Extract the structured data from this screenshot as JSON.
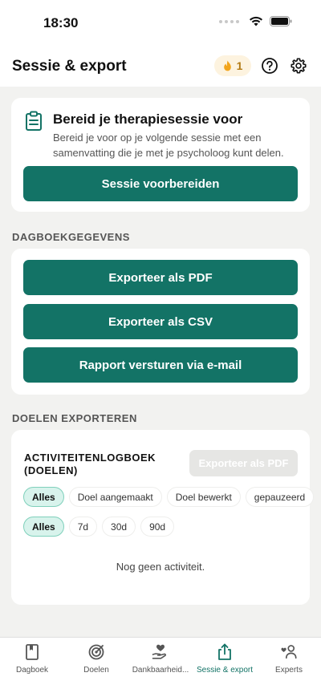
{
  "status_bar": {
    "time": "18:30"
  },
  "header": {
    "title": "Sessie & export",
    "streak_count": "1"
  },
  "session": {
    "title": "Bereid je therapiesessie voor",
    "description": "Bereid je voor op je volgende sessie met een samenvatting die je met je psycholoog kunt delen.",
    "button_label": "Sessie voorbereiden"
  },
  "diary": {
    "section_label": "DAGBOEKGEGEVENS",
    "buttons": [
      "Exporteer als PDF",
      "Exporteer als CSV",
      "Rapport versturen via e-mail"
    ]
  },
  "goals": {
    "section_label": "DOELEN EXPORTEREN",
    "log_title": "ACTIVITEITENLOGBOEK (DOELEN)",
    "export_button": "Exporteer als PDF",
    "type_filters": [
      "Alles",
      "Doel aangemaakt",
      "Doel bewerkt",
      "gepauzeerd"
    ],
    "period_filters": [
      "Alles",
      "7d",
      "30d",
      "90d"
    ],
    "empty_text": "Nog geen activiteit."
  },
  "tabs": [
    {
      "label": "Dagboek",
      "icon": "book-icon"
    },
    {
      "label": "Doelen",
      "icon": "target-icon"
    },
    {
      "label": "Dankbaarheid...",
      "icon": "heart-hand-icon"
    },
    {
      "label": "Sessie & export",
      "icon": "share-icon"
    },
    {
      "label": "Experts",
      "icon": "people-icon"
    }
  ],
  "colors": {
    "accent": "#137366",
    "chip_active": "#d8f3ec",
    "streak_bg": "#fdf3df",
    "flame": "#f2a41b"
  }
}
